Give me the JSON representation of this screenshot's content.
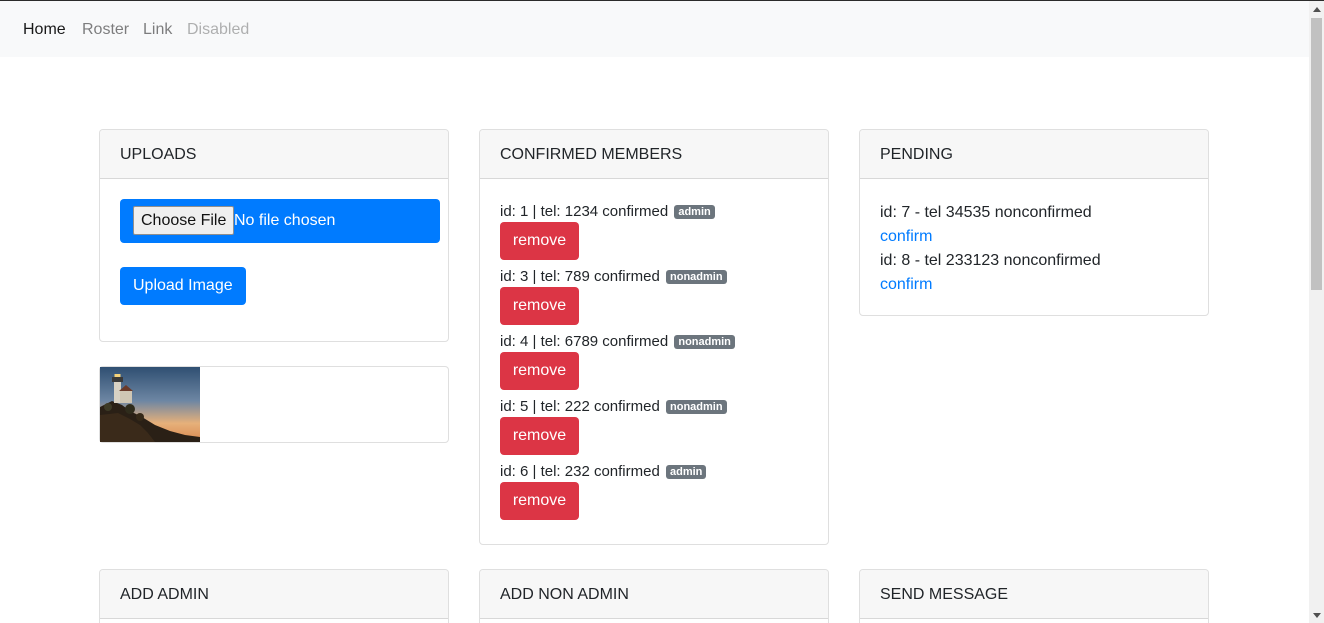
{
  "nav": {
    "items": [
      {
        "label": "Home",
        "state": "active"
      },
      {
        "label": "Roster",
        "state": "normal"
      },
      {
        "label": "Link",
        "state": "normal"
      },
      {
        "label": "Disabled",
        "state": "disabled"
      }
    ]
  },
  "uploads": {
    "title": "UPLOADS",
    "choose_file_label": "Choose File",
    "no_file_text": "No file chosen",
    "upload_button": "Upload Image"
  },
  "image_card": {
    "thumbnail_icon": "lighthouse-thumbnail"
  },
  "confirmed": {
    "title": "CONFIRMED MEMBERS",
    "members": [
      {
        "text": "id: 1 | tel: 1234 confirmed",
        "badge": "admin",
        "button": "remove"
      },
      {
        "text": "id: 3 | tel: 789 confirmed",
        "badge": "nonadmin",
        "button": "remove"
      },
      {
        "text": "id: 4 | tel: 6789 confirmed",
        "badge": "nonadmin",
        "button": "remove"
      },
      {
        "text": "id: 5 | tel: 222 confirmed",
        "badge": "nonadmin",
        "button": "remove"
      },
      {
        "text": "id: 6 | tel: 232 confirmed",
        "badge": "admin",
        "button": "remove"
      }
    ]
  },
  "pending": {
    "title": "PENDING",
    "items": [
      {
        "text": "id: 7 - tel 34535 nonconfirmed",
        "action": "confirm"
      },
      {
        "text": "id: 8 - tel 233123 nonconfirmed",
        "action": "confirm"
      }
    ]
  },
  "bottom_cards": {
    "add_admin": "ADD ADMIN",
    "add_non_admin": "ADD NON ADMIN",
    "send_message": "SEND MESSAGE"
  },
  "colors": {
    "primary": "#007bff",
    "danger": "#dc3545",
    "badge": "#6c757d",
    "navbar_bg": "#f8f9fa"
  }
}
